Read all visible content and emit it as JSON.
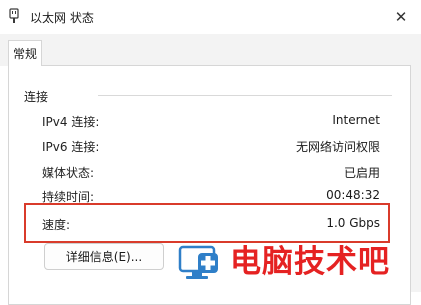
{
  "window": {
    "title": "以太网 状态",
    "close_glyph": "✕"
  },
  "tabs": [
    {
      "label": "常规"
    }
  ],
  "connection": {
    "group_label": "连接",
    "rows": [
      {
        "key": "IPv4 连接:",
        "value": "Internet"
      },
      {
        "key": "IPv6 连接:",
        "value": "无网络访问权限"
      },
      {
        "key": "媒体状态:",
        "value": "已启用"
      },
      {
        "key": "持续时间:",
        "value": "00:48:32"
      },
      {
        "key": "速度:",
        "value": "1.0 Gbps"
      }
    ]
  },
  "buttons": {
    "details_label": "详细信息(E)..."
  },
  "watermark": {
    "text": "电脑技术吧"
  },
  "colors": {
    "highlight": "#d93b2b",
    "watermark": "#e52222",
    "watermark_icon": "#2f7fc8"
  },
  "icons": {
    "title": "network-adapter-icon",
    "watermark": "computer-medical-cross-icon"
  }
}
